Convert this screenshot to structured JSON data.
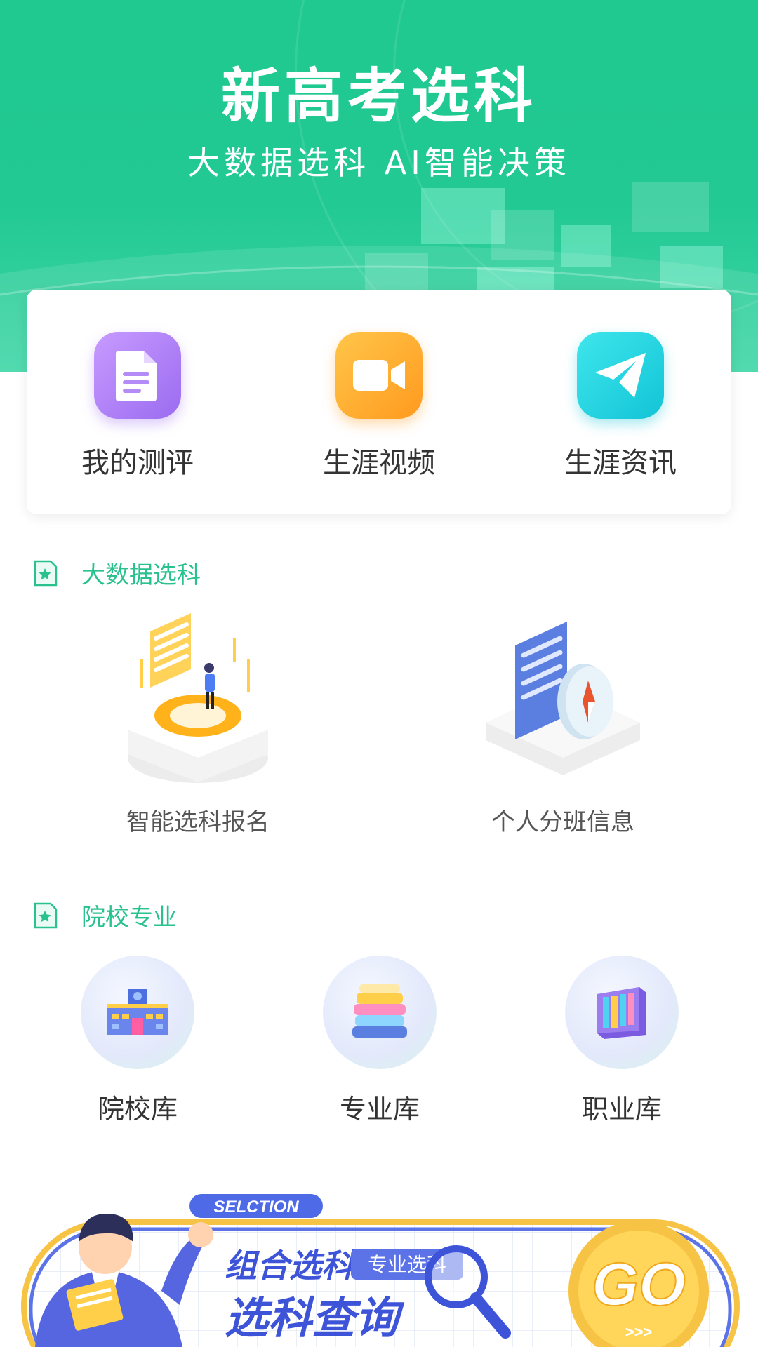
{
  "header": {
    "title": "新高考选科",
    "subtitle": "大数据选科 AI智能决策"
  },
  "quick_links": [
    {
      "label": "我的测评",
      "icon": "document-icon",
      "color": "#a87cf5"
    },
    {
      "label": "生涯视频",
      "icon": "video-camera-icon",
      "color": "#ffad2e"
    },
    {
      "label": "生涯资讯",
      "icon": "paper-plane-icon",
      "color": "#1fd0df"
    }
  ],
  "big_data": {
    "heading": "大数据选科",
    "items": [
      {
        "label": "智能选科报名",
        "icon": "person-on-platform-illustration"
      },
      {
        "label": "个人分班信息",
        "icon": "document-compass-illustration"
      }
    ]
  },
  "colleges": {
    "heading": "院校专业",
    "items": [
      {
        "label": "院校库",
        "icon": "school-building-icon"
      },
      {
        "label": "专业库",
        "icon": "book-stack-icon"
      },
      {
        "label": "职业库",
        "icon": "bookshelf-icon"
      }
    ]
  },
  "banner": {
    "tag": "SELCTION",
    "line1": "组合选科",
    "badge": "专业选科",
    "line2": "选科查询",
    "go": "GO",
    "arrows": ">>>"
  },
  "colors": {
    "accent": "#22c993",
    "section_title": "#29c28f"
  }
}
